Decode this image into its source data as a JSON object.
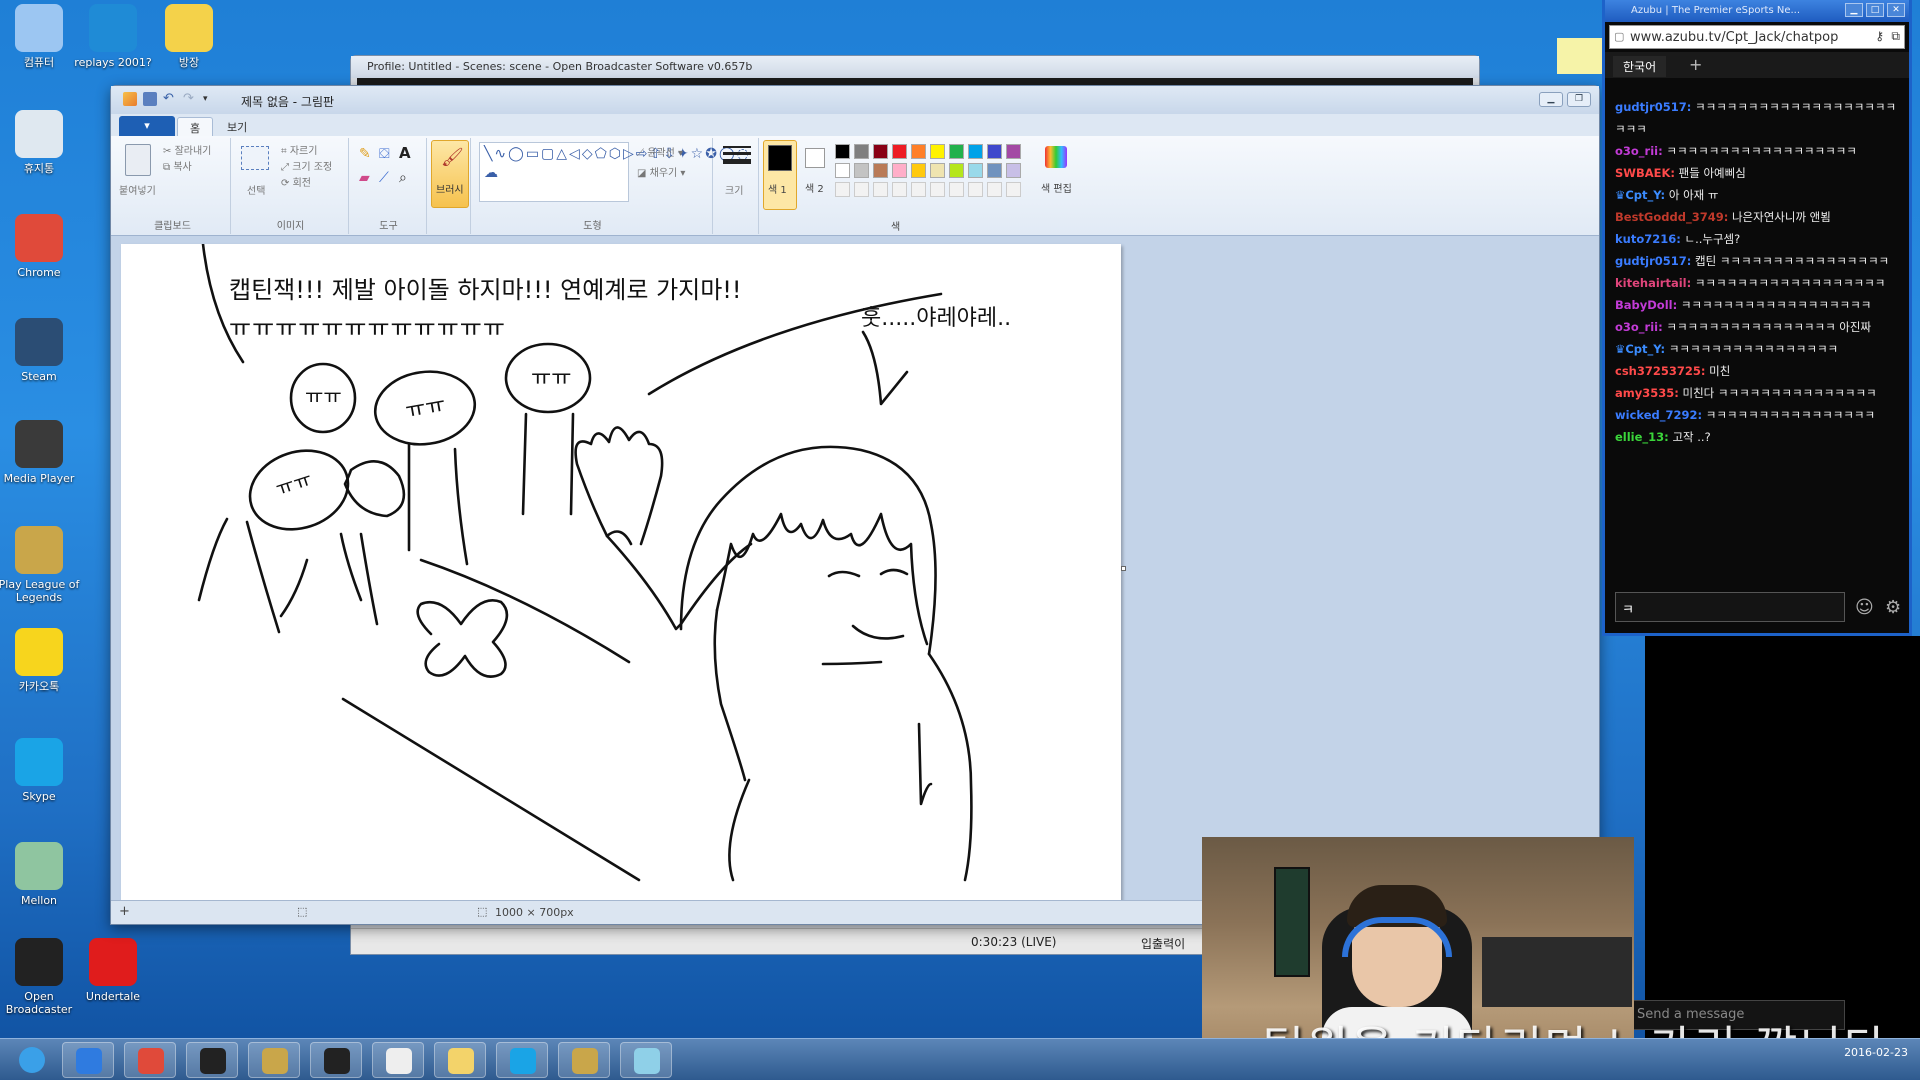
{
  "desktop": {
    "icons": [
      {
        "label": "컴퓨터",
        "icon": "computer-icon",
        "color": "#9cc6f2"
      },
      {
        "label": "replays 2001?",
        "icon": "replays-icon",
        "color": "#1f8bd6"
      },
      {
        "label": "방장",
        "icon": "mascot-icon",
        "color": "#f4d24a"
      },
      {
        "label": "휴지통",
        "icon": "recycle-bin-icon",
        "color": "#dfe8f0"
      },
      {
        "label": "Chrome",
        "icon": "chrome-icon",
        "color": "#e04a3a"
      },
      {
        "label": "Steam",
        "icon": "steam-icon",
        "color": "#2b4d74"
      },
      {
        "label": "Media Player",
        "icon": "media-player-icon",
        "color": "#3a3a3a"
      },
      {
        "label": "Play League of Legends",
        "icon": "league-icon",
        "color": "#c9a64a"
      },
      {
        "label": "카카오톡",
        "icon": "kakaotalk-icon",
        "color": "#f7d51d"
      },
      {
        "label": "Skype",
        "icon": "skype-icon",
        "color": "#1aa4e6"
      },
      {
        "label": "Mellon",
        "icon": "melon-icon",
        "color": "#8fc5a0"
      },
      {
        "label": "Open Broadcaster",
        "icon": "obs-icon",
        "color": "#222222"
      },
      {
        "label": "Undertale",
        "icon": "heart-icon",
        "color": "#e01c1c"
      }
    ]
  },
  "obs": {
    "title": "Profile: Untitled - Scenes: scene - Open Broadcaster Software v0.657b",
    "status_time": "0:30:23 (LIVE)",
    "status_lang": "입출력이",
    "send_placeholder": "Send a message"
  },
  "paint": {
    "title": "제목 없음 - 그림판",
    "file_tab": "▾",
    "tabs": [
      "홈",
      "보기"
    ],
    "clipboard": {
      "paste": "붙여넣기",
      "cut": "잘라내기",
      "copy": "복사",
      "group": "클립보드"
    },
    "image": {
      "select": "선택",
      "crop": "자르기",
      "resize": "크기 조정",
      "rotate": "회전",
      "group": "이미지"
    },
    "tools_group": "도구",
    "brush": "브러시",
    "shapes": {
      "outline": "윤곽선",
      "fill": "채우기",
      "group": "도형"
    },
    "size": "크기",
    "color1": "색 1",
    "color2": "색 2",
    "edit_colors": "색 편집",
    "colors_group": "색",
    "palette_top": [
      "#000000",
      "#7f7f7f",
      "#880015",
      "#ed1c24",
      "#ff7f27",
      "#fff200",
      "#22b14c",
      "#00a2e8",
      "#3f48cc",
      "#a349a4"
    ],
    "palette_mid": [
      "#ffffff",
      "#c3c3c3",
      "#b97a57",
      "#ffaec9",
      "#ffc90e",
      "#efe4b0",
      "#b5e61d",
      "#99d9ea",
      "#7092be",
      "#c8bfe7"
    ],
    "status_size": "1000 × 700px",
    "canvas_text": {
      "line1": "캡틴잭!!! 제발 아이돌 하지마!!! 연예계로 가지마!!",
      "line2": "ㅠㅠㅠㅠㅠㅠㅠㅠㅠㅠㅠㅠ",
      "bubble": "훗.....야레야레..",
      "face1": "ㅠㅠ",
      "face2": "ㅠㅠ",
      "face3": "ㅠㅠ",
      "face4": "ㅠㅠ"
    }
  },
  "chat": {
    "window_title": "Azubu | The Premier eSports Ne...",
    "url": "www.azubu.tv/Cpt_Jack/chatpop",
    "tab_label": "한국어",
    "tab_add": "+",
    "input_value": "ㅋ",
    "messages": [
      {
        "user": "gudtjr0517:",
        "color": "#3a7cff",
        "text": "ㅋㅋㅋㅋㅋㅋㅋㅋㅋㅋㅋㅋㅋㅋㅋㅋㅋㅋㅋㅋㅋㅋ",
        "crown": false
      },
      {
        "user": "o3o_rii:",
        "color": "#c23bd6",
        "text": "ㅋㅋㅋㅋㅋㅋㅋㅋㅋㅋㅋㅋㅋㅋㅋㅋㅋㅋ",
        "crown": false
      },
      {
        "user": "SWBAEK:",
        "color": "#ff4a4a",
        "text": "팬들 아예삐심",
        "crown": false
      },
      {
        "user": "Cpt_Y:",
        "color": "#3b8cff",
        "text": "아 아재 ㅠ",
        "crown": true
      },
      {
        "user": "BestGoddd_3749:",
        "color": "#c0392b",
        "text": "나은자연사니까 앤뵘",
        "crown": false
      },
      {
        "user": "kuto7216:",
        "color": "#3a7cff",
        "text": "ㄴ..누구셈?",
        "crown": false
      },
      {
        "user": "gudtjr0517:",
        "color": "#3a7cff",
        "text": "캡틴 ㅋㅋㅋㅋㅋㅋㅋㅋㅋㅋㅋㅋㅋㅋㅋㅋ",
        "crown": false
      },
      {
        "user": "kitehairtail:",
        "color": "#e0457b",
        "text": "ㅋㅋㅋㅋㅋㅋㅋㅋㅋㅋㅋㅋㅋㅋㅋㅋㅋㅋ",
        "crown": false
      },
      {
        "user": "BabyDoll:",
        "color": "#c23bd6",
        "text": "ㅋㅋㅋㅋㅋㅋㅋㅋㅋㅋㅋㅋㅋㅋㅋㅋㅋㅋ",
        "crown": false
      },
      {
        "user": "o3o_rii:",
        "color": "#c23bd6",
        "text": "ㅋㅋㅋㅋㅋㅋㅋㅋㅋㅋㅋㅋㅋㅋㅋㅋ 아진짜",
        "crown": false
      },
      {
        "user": "Cpt_Y:",
        "color": "#3b8cff",
        "text": "ㅋㅋㅋㅋㅋㅋㅋㅋㅋㅋㅋㅋㅋㅋㅋㅋ",
        "crown": true
      },
      {
        "user": "csh37253725:",
        "color": "#ff4a4a",
        "text": "미친",
        "crown": false
      },
      {
        "user": "amy3535:",
        "color": "#ff4a4a",
        "text": "미친다 ㅋㅋㅋㅋㅋㅋㅋㅋㅋㅋㅋㅋㅋㅋㅋ",
        "crown": false
      },
      {
        "user": "wicked_7292:",
        "color": "#3a7cff",
        "text": "ㅋㅋㅋㅋㅋㅋㅋㅋㅋㅋㅋㅋㅋㅋㅋㅋ",
        "crown": false
      },
      {
        "user": "ellie_13:",
        "color": "#3ad63a",
        "text": "고작 ..?",
        "crown": false
      }
    ]
  },
  "stream": {
    "subtitle": "팀원을 기다리며 노가리 깝니다"
  },
  "taskbar": {
    "items": [
      "start-orb-icon",
      "internet-explorer-icon",
      "chrome-icon",
      "media-icon",
      "league-icon",
      "obs-icon",
      "notepad-icon",
      "folder-icon",
      "skype-icon",
      "league-icon",
      "paint-icon"
    ],
    "clock_date": "2016-02-23"
  }
}
